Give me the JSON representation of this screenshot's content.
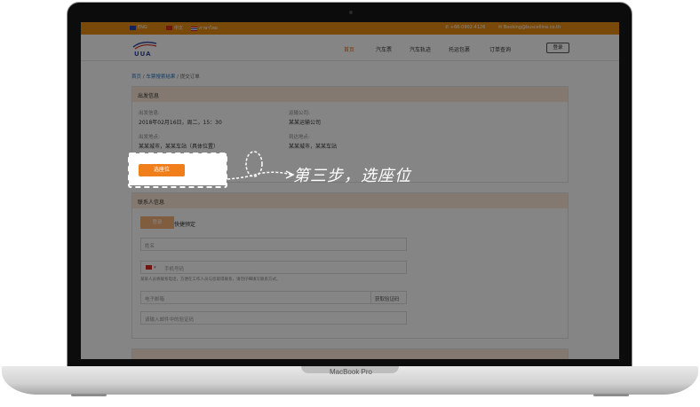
{
  "device": {
    "label": "MacBook Pro"
  },
  "topbar": {
    "langs": [
      {
        "name": "ENG",
        "color": "#1f4aa8"
      },
      {
        "name": "中文",
        "color": "#d62b1f"
      },
      {
        "name": "ภาษาไทย",
        "color": "#2f3f9e"
      }
    ],
    "phone": "+66-0902-4126",
    "email": "Booking@buscelline.co.th"
  },
  "logo": {
    "text": "UUA"
  },
  "nav": {
    "items": [
      "首页",
      "汽车票",
      "汽车轨迹",
      "托运包裹",
      "订单查询"
    ],
    "active_index": 0,
    "login": "登录"
  },
  "breadcrumb": {
    "items": [
      "首页",
      "车票搜索结果",
      "提交订单"
    ],
    "separator": "/"
  },
  "trip": {
    "header": "出发信息",
    "depart_time_label": "出发信息:",
    "depart_time": "2018年02月16日，周二，15：30",
    "company_label": "运输公司:",
    "company": "某某运输公司",
    "origin_label": "出发地点:",
    "origin": "某某城市，某某车站（具体位置）",
    "destination_label": "到达地点:",
    "destination": "某某城市，某某车站",
    "select_seat_button": "选座位"
  },
  "contact": {
    "header": "联系人信息",
    "login_btn": "登录",
    "quick_book": "快捷预定",
    "name_placeholder": "姓名",
    "phone_code": "▾",
    "phone_placeholder": "手机号码",
    "phone_note": "某某人员将联系电话，方便在工作人员与您取得联系，请勿仔细填写联系方式。",
    "email_placeholder": "电子邮箱",
    "get_code": "获取验证码",
    "code_placeholder": "请输入邮件中的验证码"
  },
  "annotation": {
    "text": "第三步，选座位"
  },
  "colors": {
    "brand": "#e88c14",
    "button": "#f07e1a",
    "panel_header": "#fbe8d6"
  }
}
